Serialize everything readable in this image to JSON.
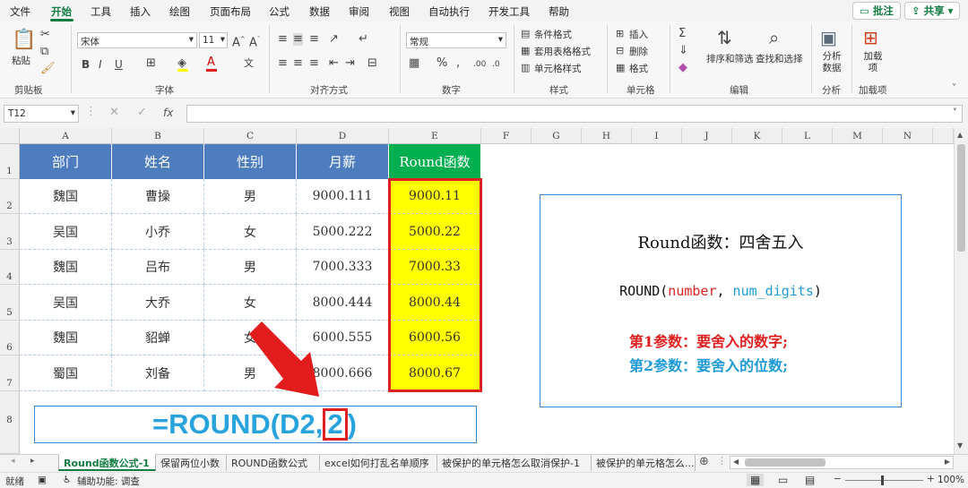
{
  "menu": {
    "items": [
      "文件",
      "开始",
      "工具",
      "插入",
      "绘图",
      "页面布局",
      "公式",
      "数据",
      "审阅",
      "视图",
      "自动执行",
      "开发工具",
      "帮助"
    ],
    "comment_btn": "批注",
    "share_btn": "共享"
  },
  "ribbon": {
    "paste": "粘贴",
    "font_name": "宋体",
    "font_size": "11",
    "number_format": "常规",
    "cond_format": "条件格式",
    "table_format": "套用表格格式",
    "cell_style": "单元格样式",
    "insert": "插入",
    "delete": "删除",
    "format": "格式",
    "sort_filter": "排序和筛选",
    "find_select": "查找和选择",
    "analyze": "分析数据",
    "addins": "加载项",
    "groups": [
      "剪贴板",
      "字体",
      "对齐方式",
      "数字",
      "样式",
      "单元格",
      "编辑",
      "分析",
      "加载项"
    ]
  },
  "formula": {
    "name_box": "T12",
    "fx": "fx",
    "content": ""
  },
  "columns": [
    "A",
    "B",
    "C",
    "D",
    "E",
    "F",
    "G",
    "H",
    "I",
    "J",
    "K",
    "L",
    "M",
    "N"
  ],
  "rows": [
    "1",
    "2",
    "3",
    "4",
    "5",
    "6",
    "7",
    "8"
  ],
  "table": {
    "headers": [
      "部门",
      "姓名",
      "性别",
      "月薪",
      "Round函数"
    ],
    "rows": [
      [
        "魏国",
        "曹操",
        "男",
        "9000.111",
        "9000.11"
      ],
      [
        "吴国",
        "小乔",
        "女",
        "5000.222",
        "5000.22"
      ],
      [
        "魏国",
        "吕布",
        "男",
        "7000.333",
        "7000.33"
      ],
      [
        "吴国",
        "大乔",
        "女",
        "8000.444",
        "8000.44"
      ],
      [
        "魏国",
        "貂蝉",
        "女",
        "6000.555",
        "6000.56"
      ],
      [
        "蜀国",
        "刘备",
        "男",
        "8000.666",
        "8000.67"
      ]
    ],
    "colors": {
      "header_bg": "#4d7dbf",
      "round_header_bg": "#00b050",
      "highlight": "#ffff00",
      "red": "#e02020"
    }
  },
  "formula_box": {
    "prefix": "=ROUND(D2,",
    "highlight": "2",
    "suffix": ")"
  },
  "infobox": {
    "title": "Round函数：四舍五入",
    "syntax_fn": "ROUND(",
    "syntax_p1": "number",
    "syntax_sep": ", ",
    "syntax_p2": "num_digits",
    "syntax_end": ")",
    "line1": "第1参数：要舍入的数字;",
    "line2": "第2参数：要舍入的位数;"
  },
  "tabs": [
    "Round函数公式-1",
    "保留两位小数",
    "ROUND函数公式",
    "excel如何打乱名单顺序",
    "被保护的单元格怎么取消保护-1",
    "被保护的单元格怎么..."
  ],
  "status": {
    "ready": "就绪",
    "accessibility": "辅助功能: 调查",
    "zoom": "100%"
  }
}
